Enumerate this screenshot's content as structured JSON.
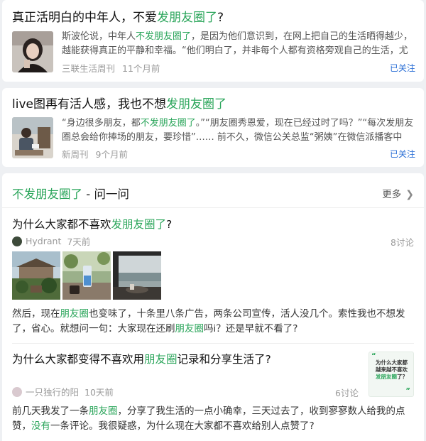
{
  "articles": [
    {
      "title_prefix": "真正活明白的中年人，不爱",
      "title_highlight": "发朋友圈了",
      "title_suffix": "?",
      "snippet_a": "斯波伦说，中年人",
      "snippet_hl": "不发朋友圈了",
      "snippet_b": "，是因为他们意识到，在网上把自己的生活晒得越少，越能获得真正的平静和幸福。“他们明白了，并非每个人都有资格旁观自己的生活，尤其...",
      "source": "三联生活周刊",
      "time": "11个月前",
      "follow": "已关注"
    },
    {
      "title_prefix": "live图再有活人感，我也不想",
      "title_highlight": "发朋友圈了",
      "title_suffix": "",
      "snippet_a": "“身边很多朋友，都",
      "snippet_hl": "不发朋友圈了",
      "snippet_b": "。”“朋友圈秀恩爱，现在已经过时了吗？”“每次发朋友圈总会给你捧场的朋友，要珍惜”…… 前不久，微信公关总监“粥姨”在微信派播客中回...",
      "source": "新周刊",
      "time": "9个月前",
      "follow": "已关注"
    }
  ],
  "topic": {
    "title_highlight": "不发朋友圈了",
    "title_suffix": " - 问一问",
    "more": "更多",
    "questions": [
      {
        "title_prefix": "为什么大家都不喜欢",
        "title_highlight": "发朋友圈了",
        "title_suffix": "?",
        "user": "Hydrant",
        "time": "7天前",
        "count": "8讨论",
        "body_a": "然后，现在",
        "body_hl1": "朋友圈",
        "body_b": "也变味了，十条里八条广告，两条公司宣传，活人没几个。索性我也不想发了，省心。就想问一句：大家现在还刷",
        "body_hl2": "朋友圈",
        "body_c": "吗i？还是早就不看了?"
      },
      {
        "title_prefix": "为什么大家都变得不喜欢用",
        "title_highlight": "朋友圈",
        "title_suffix": "记录和分享生活了?",
        "user": "一只独行的阳",
        "time": "10天前",
        "count": "6讨论",
        "thumb_a": "为什么大家都越来越不喜欢",
        "thumb_hl": "发朋友圈",
        "thumb_b": "了？",
        "body_a": "前几天我发了一条",
        "body_hl1": "朋友圈",
        "body_b": "，分享了我生活的一点小确幸，三天过去了，收到寥寥数人给我的点赞，",
        "body_hl2": "没有",
        "body_c": "一条评论。我很疑惑，为什么现在大家都不喜欢给别人点赞了?"
      }
    ]
  },
  "colors": {
    "highlight": "#2aa55a",
    "follow": "#2b6fd6",
    "meta": "#9a9a9a"
  }
}
